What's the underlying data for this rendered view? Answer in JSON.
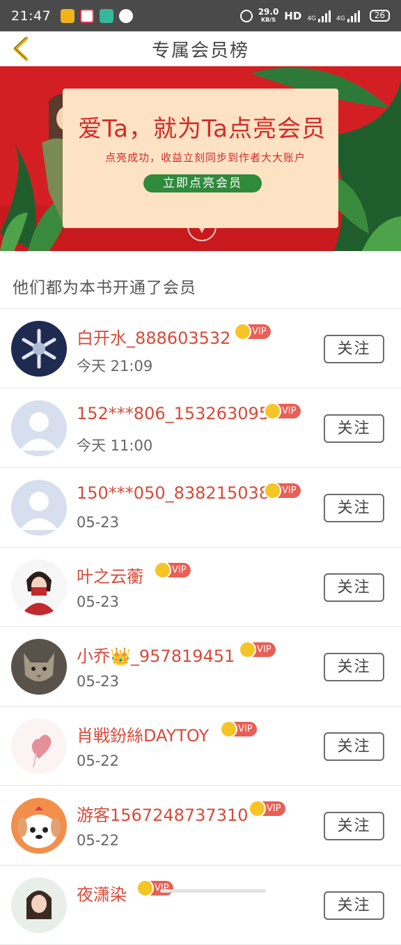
{
  "status_bar": {
    "time": "21:47",
    "speed": "29.0",
    "speed_unit": "KB/S",
    "hd_label": "HD",
    "net1": "4G",
    "net2": "4G",
    "battery": "26"
  },
  "header": {
    "title": "专属会员榜"
  },
  "banner": {
    "title": "爱Ta，就为Ta点亮会员",
    "subtitle": "点亮成功，收益立刻同步到作者大大账户",
    "button_label": "立即点亮会员",
    "colors": {
      "background": "#d31f23",
      "card": "#fde3c3",
      "button": "#2f8a3c"
    }
  },
  "section": {
    "title": "他们都为本书开通了会员"
  },
  "vip_label": "VIP",
  "follow_label": "关注",
  "members": [
    {
      "name": "白开水_888603532",
      "time": "今天 21:09",
      "avatar": "snowflake-avatar"
    },
    {
      "name": "152***806_153263095",
      "time": "今天 11:00",
      "avatar": "default-avatar"
    },
    {
      "name": "150***050_838215038",
      "time": "05-23",
      "avatar": "default-avatar"
    },
    {
      "name": "叶之云蘅",
      "time": "05-23",
      "avatar": "girl-avatar"
    },
    {
      "name": "小乔👑_957819451",
      "time": "05-23",
      "avatar": "cat-avatar"
    },
    {
      "name": "肖戦鈖絲DAYTOY",
      "time": "05-22",
      "avatar": "heart-avatar"
    },
    {
      "name": "游客1567248737310",
      "time": "05-22",
      "avatar": "puppy-avatar"
    },
    {
      "name": "夜潇染",
      "time": "",
      "avatar": "girl-avatar-2"
    }
  ],
  "colors": {
    "name": "#d84a38",
    "vip_badge": "#e95f55",
    "crown": "#f5c525"
  }
}
